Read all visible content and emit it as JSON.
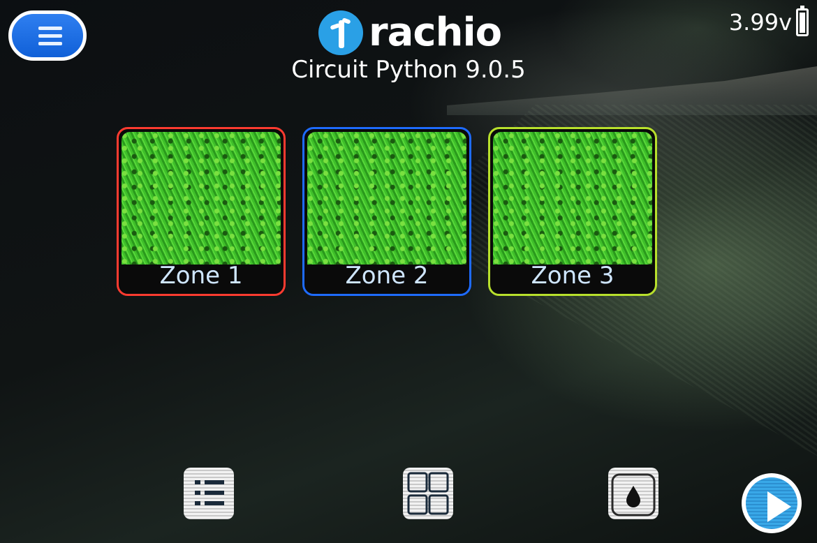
{
  "header": {
    "brand": "rachio",
    "subtitle": "Circuit Python 9.0.5",
    "battery_voltage": "3.99v",
    "battery_level": 0.85
  },
  "zones": [
    {
      "label": "Zone 1",
      "border_color": "#ff3b30"
    },
    {
      "label": "Zone 2",
      "border_color": "#1e6bff"
    },
    {
      "label": "Zone 3",
      "border_color": "#b8e02c"
    }
  ],
  "nav": {
    "items": [
      "list-icon",
      "grid-icon",
      "water-drop-icon",
      "play-icon"
    ]
  },
  "colors": {
    "accent_blue": "#2aa0e6",
    "menu_blue": "#1f72e8",
    "text": "#ffffff",
    "zone_label": "#cfe6ff"
  }
}
